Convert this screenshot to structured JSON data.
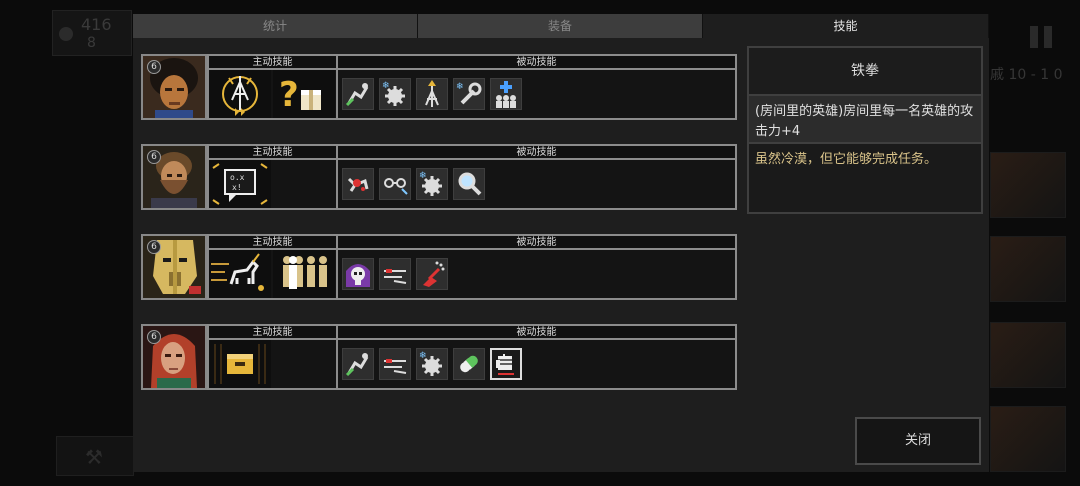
{
  "background": {
    "resource_count": "416",
    "secondary_count": "8",
    "wave_text": "戚 10 - 1 0"
  },
  "tabs": [
    {
      "label": "统计",
      "active": false
    },
    {
      "label": "装备",
      "active": false
    },
    {
      "label": "技能",
      "active": true
    }
  ],
  "section_headers": {
    "active": "主动技能",
    "passive": "被动技能"
  },
  "heroes": [
    {
      "level": "6",
      "portrait_icon": "afro-hero-portrait",
      "active_skills": [
        "lightning-tower-skill-icon",
        "mystery-box-skill-icon"
      ],
      "passive_skills": [
        "crawl-poison-icon",
        "gear-frost-icon",
        "tower-boost-icon",
        "wrench-frost-icon",
        "team-heal-icon"
      ]
    },
    {
      "level": "6",
      "portrait_icon": "bearded-hero-portrait",
      "active_skills": [
        "radar-chip-skill-icon"
      ],
      "passive_skills": [
        "blood-splat-icon",
        "goggles-icon",
        "gear-frost-icon",
        "magnifier-icon"
      ]
    },
    {
      "level": "6",
      "portrait_icon": "robot-hero-portrait",
      "active_skills": [
        "unicorn-charge-skill-icon",
        "clone-squad-skill-icon"
      ],
      "passive_skills": [
        "skull-hood-icon",
        "red-dash-icon",
        "spray-can-icon"
      ]
    },
    {
      "level": "6",
      "portrait_icon": "redhead-hero-portrait",
      "active_skills": [
        "supply-crate-skill-icon"
      ],
      "passive_skills": [
        "crawl-poison-icon",
        "red-dash-icon",
        "gear-frost-icon",
        "pill-icon",
        "iron-fist-icon"
      ]
    }
  ],
  "info": {
    "title": "铁拳",
    "description": "(房间里的英雄)房间里每一名英雄的攻击力+4",
    "flavor": "虽然冷漠，但它能够完成任务。"
  },
  "close_label": "关闭",
  "colors": {
    "flavor_text": "#d9c38a",
    "panel_bg": "#1e1e1e",
    "tab_inactive": "#3d3d3d",
    "frost_blue": "#7fc8ff",
    "gold": "#e6b63a"
  }
}
